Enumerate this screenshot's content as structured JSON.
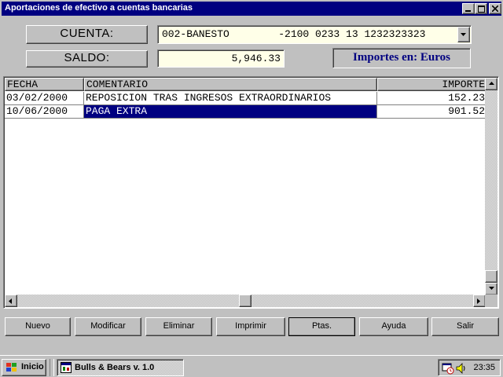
{
  "window": {
    "title": "Aportaciones de efectivo a cuentas bancarias",
    "minimize": "_",
    "maximize": "□",
    "close": "✕"
  },
  "form": {
    "cuenta_label": "CUENTA:",
    "cuenta_value": "002-BANESTO        -2100 0233 13 1232323323",
    "saldo_label": "SALDO:",
    "saldo_value": "5,946.33",
    "importes_label": "Importes en:  Euros"
  },
  "grid": {
    "columns": [
      "FECHA",
      "COMENTARIO",
      "IMPORTE"
    ],
    "rows": [
      {
        "fecha": "03/02/2000",
        "comentario": "REPOSICION TRAS INGRESOS EXTRAORDINARIOS",
        "importe": "152.23"
      },
      {
        "fecha": "10/06/2000",
        "comentario": "PAGA EXTRA",
        "importe": "901.52"
      }
    ]
  },
  "buttons": {
    "nuevo": "Nuevo",
    "modificar": "Modificar",
    "eliminar": "Eliminar",
    "imprimir": "Imprimir",
    "ptas": "Ptas.",
    "ayuda": "Ayuda",
    "salir": "Salir"
  },
  "taskbar": {
    "start": "Inicio",
    "app": "Bulls & Bears v. 1.0",
    "clock": "23:35"
  },
  "colors": {
    "titlebar": "#000080",
    "selection": "#000080",
    "field_bg": "#ffffe8",
    "accent_text": "#000080"
  }
}
